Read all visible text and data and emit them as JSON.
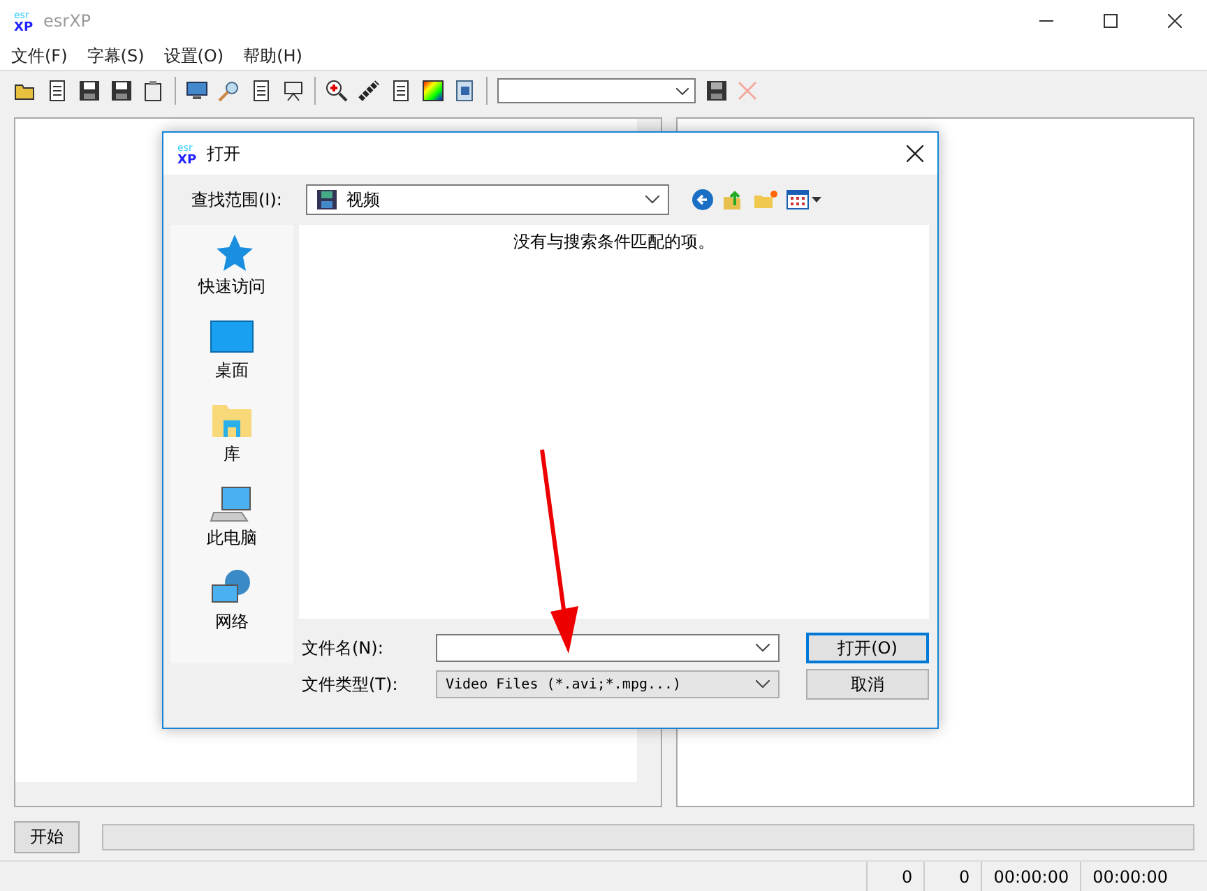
{
  "window": {
    "title": "esrXP",
    "logo_top": "esr",
    "logo_bottom": "XP"
  },
  "menu": [
    {
      "label": "文件(F)"
    },
    {
      "label": "字幕(S)"
    },
    {
      "label": "设置(O)"
    },
    {
      "label": "帮助(H)"
    }
  ],
  "toolbar": {
    "combo_disabled_delete": true
  },
  "bottom": {
    "start_button": "开始",
    "progress": {
      "level": 0
    }
  },
  "dialog_logo": {
    "top": "esr",
    "bottom": "XP"
  },
  "status_bar": [
    "0",
    "0",
    "00:00:00",
    "00:00:00"
  ],
  "dialog": {
    "title": "打开",
    "look_in_label": "查找范围(I):",
    "look_in_value": "视频",
    "empty_message": "没有与搜索条件匹配的项。",
    "places": [
      {
        "label": "快速访问",
        "kind": "star"
      },
      {
        "label": "桌面",
        "kind": "desktop"
      },
      {
        "label": "库",
        "kind": "library"
      },
      {
        "label": "此电脑",
        "kind": "computer"
      },
      {
        "label": "网络",
        "kind": "network"
      }
    ],
    "filename_label": "文件名(N):",
    "filetype_label": "文件类型(T):",
    "filetype_value": "Video Files (*.avi;*.mpg...)",
    "buttons": [
      {
        "label": "打开(O)",
        "default": true
      },
      {
        "label": "取消",
        "default": false
      }
    ]
  }
}
